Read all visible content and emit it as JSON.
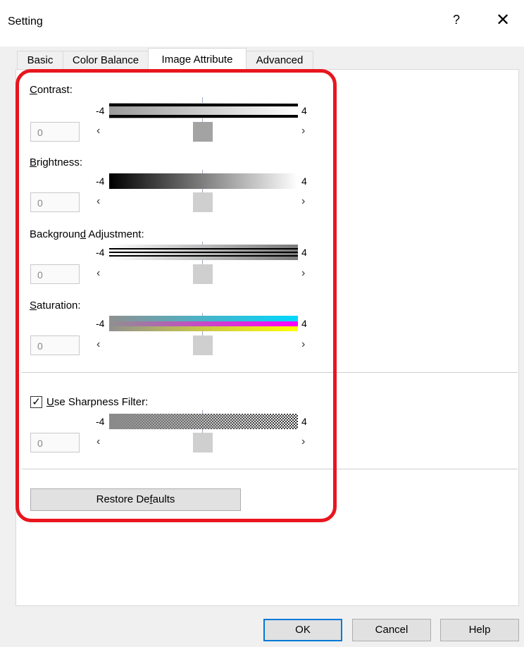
{
  "dialog": {
    "title": "Setting",
    "help_glyph": "?",
    "close_glyph": "✕"
  },
  "tabs": [
    {
      "label": "Basic",
      "active": false
    },
    {
      "label": "Color Balance",
      "active": false
    },
    {
      "label": "Image Attribute",
      "active": true
    },
    {
      "label": "Advanced",
      "active": false
    }
  ],
  "sliders": {
    "contrast": {
      "label_pre": "",
      "label_key": "C",
      "label_post": "ontrast:",
      "min_label": "-4",
      "max_label": "4",
      "value": "0",
      "left_arrow": "‹",
      "right_arrow": "›"
    },
    "brightness": {
      "label_pre": "",
      "label_key": "B",
      "label_post": "rightness:",
      "min_label": "-4",
      "max_label": "4",
      "value": "0",
      "left_arrow": "‹",
      "right_arrow": "›"
    },
    "background": {
      "label_pre": "Backgroun",
      "label_key": "d",
      "label_post": " Adjustment:",
      "min_label": "-4",
      "max_label": "4",
      "value": "0",
      "left_arrow": "‹",
      "right_arrow": "›"
    },
    "saturation": {
      "label_pre": "",
      "label_key": "S",
      "label_post": "aturation:",
      "min_label": "-4",
      "max_label": "4",
      "value": "0",
      "left_arrow": "‹",
      "right_arrow": "›"
    },
    "sharpness": {
      "label_pre": "",
      "label_key": "U",
      "label_post": "se Sharpness Filter:",
      "min_label": "-4",
      "max_label": "4",
      "value": "0",
      "left_arrow": "‹",
      "right_arrow": "›",
      "checked": true,
      "check_glyph": "✓"
    }
  },
  "buttons": {
    "restore_pre": "Restore De",
    "restore_key": "f",
    "restore_post": "aults",
    "ok": "OK",
    "cancel": "Cancel",
    "help": "Help"
  },
  "colors": {
    "highlight_ring": "#e8161e",
    "default_button_border": "#0078d7"
  }
}
